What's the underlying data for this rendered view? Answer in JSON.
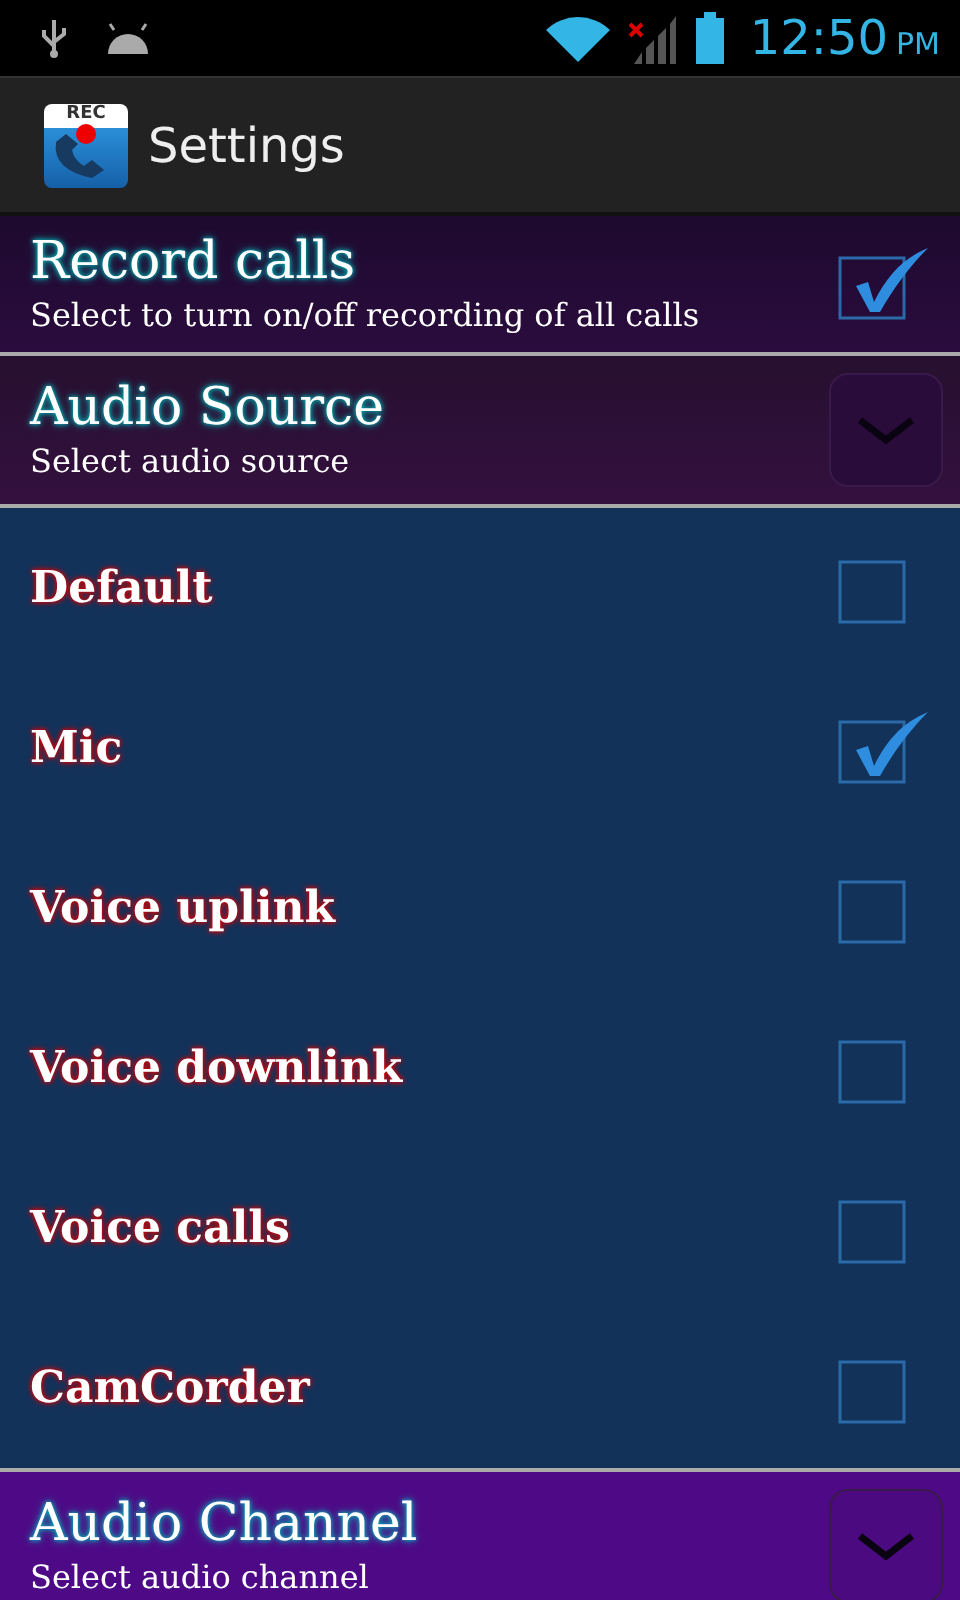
{
  "status_bar": {
    "time": "12:50",
    "ampm": "PM"
  },
  "app_bar": {
    "title": "Settings",
    "icon_label": "REC"
  },
  "preferences": [
    {
      "kind": "checkbox",
      "title": "Record calls",
      "summary": "Select to turn on/off recording of all calls",
      "checked": true
    },
    {
      "kind": "list",
      "title": "Audio Source",
      "summary": "Select audio source",
      "expanded": true,
      "options": [
        {
          "label": "Default",
          "checked": false
        },
        {
          "label": "Mic",
          "checked": true
        },
        {
          "label": "Voice uplink",
          "checked": false
        },
        {
          "label": "Voice downlink",
          "checked": false
        },
        {
          "label": "Voice calls",
          "checked": false
        },
        {
          "label": "CamCorder",
          "checked": false
        }
      ]
    },
    {
      "kind": "list",
      "title": "Audio Channel",
      "summary": "Select audio channel",
      "expanded": false
    }
  ]
}
